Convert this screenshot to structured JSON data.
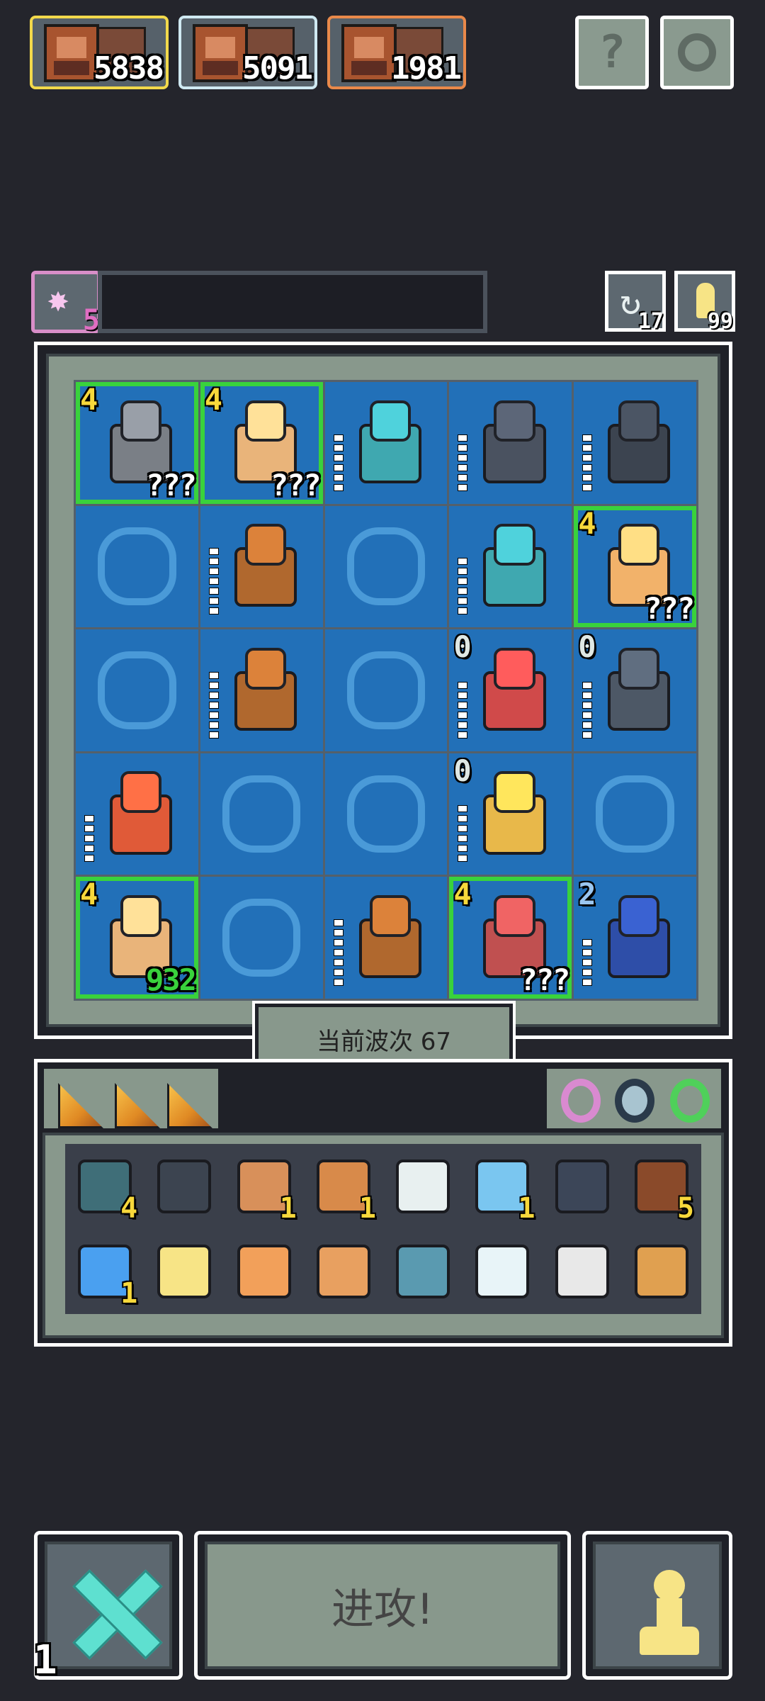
{
  "leaderboard": [
    {
      "score": "5838",
      "border": "#f2d94b"
    },
    {
      "score": "5091",
      "border": "#cfe9f2"
    },
    {
      "score": "1981",
      "border": "#e9894a"
    }
  ],
  "top_buttons": {
    "help_label": "?",
    "settings_icon": "gear-icon"
  },
  "star": {
    "icon": "star-icon",
    "count": "5"
  },
  "side": {
    "refresh_count": "17",
    "key_count": "99"
  },
  "board": {
    "rows": [
      [
        {
          "unit": "armored-knight",
          "level": "4",
          "level_color": "#f7d83b",
          "qty": "???",
          "hp": 0,
          "color": "#7a7f86",
          "highlight": "#39d23c"
        },
        {
          "unit": "musketeer",
          "level": "4",
          "level_color": "#f7d83b",
          "qty": "???",
          "hp": 0,
          "color": "#e9b47a",
          "highlight": "#39d23c"
        },
        {
          "unit": "ogre",
          "level": "",
          "qty": "",
          "hp": 6,
          "color": "#3fa8b0",
          "highlight": ""
        },
        {
          "unit": "dark-knight",
          "level": "",
          "qty": "",
          "hp": 6,
          "color": "#4a5260",
          "highlight": ""
        },
        {
          "unit": "statue",
          "level": "",
          "qty": "",
          "hp": 6,
          "color": "#3c4450",
          "highlight": ""
        }
      ],
      [
        {
          "unit": "",
          "empty": true
        },
        {
          "unit": "warrior",
          "level": "",
          "qty": "",
          "hp": 7,
          "color": "#b0682e",
          "highlight": ""
        },
        {
          "unit": "",
          "empty": true
        },
        {
          "unit": "ogre",
          "level": "",
          "qty": "",
          "hp": 6,
          "color": "#3fa8b0",
          "highlight": ""
        },
        {
          "unit": "golem",
          "level": "4",
          "level_color": "#f7d83b",
          "qty": "???",
          "hp": 0,
          "color": "#f2b26a",
          "highlight": "#39d23c"
        }
      ],
      [
        {
          "unit": "",
          "empty": true
        },
        {
          "unit": "warrior",
          "level": "",
          "qty": "",
          "hp": 7,
          "color": "#b0682e",
          "highlight": ""
        },
        {
          "unit": "",
          "empty": true
        },
        {
          "unit": "old-man",
          "level": "0",
          "level_color": "#dfe8e4",
          "qty": "",
          "hp": 6,
          "color": "#d04a4a",
          "highlight": ""
        },
        {
          "unit": "bear",
          "level": "0",
          "level_color": "#dfe8e4",
          "qty": "",
          "hp": 6,
          "color": "#4d5866",
          "highlight": ""
        }
      ],
      [
        {
          "unit": "dragon",
          "level": "",
          "qty": "",
          "hp": 5,
          "color": "#e05a38",
          "highlight": ""
        },
        {
          "unit": "",
          "empty": true
        },
        {
          "unit": "",
          "empty": true
        },
        {
          "unit": "wheat",
          "level": "0",
          "level_color": "#dfe8e4",
          "qty": "",
          "hp": 6,
          "color": "#e8b84a",
          "highlight": ""
        },
        {
          "unit": "",
          "empty": true
        }
      ],
      [
        {
          "unit": "musketeer",
          "level": "4",
          "level_color": "#f7d83b",
          "qty": "932",
          "qty_color": "#39d23c",
          "hp": 0,
          "color": "#e9b47a",
          "highlight": "#39d23c"
        },
        {
          "unit": "",
          "empty": true
        },
        {
          "unit": "warrior",
          "level": "",
          "qty": "",
          "hp": 7,
          "color": "#b0682e",
          "highlight": ""
        },
        {
          "unit": "guard",
          "level": "4",
          "level_color": "#f7d83b",
          "qty": "???",
          "hp": 0,
          "color": "#c05050",
          "highlight": "#39d23c"
        },
        {
          "unit": "vampire",
          "level": "2",
          "level_color": "#9ac6f0",
          "qty": "",
          "hp": 5,
          "color": "#2e4ea8",
          "highlight": ""
        }
      ]
    ]
  },
  "wave_label": "当前波次 67",
  "shop": {
    "cards": [
      "card-icon",
      "card-icon",
      "card-icon"
    ],
    "rings": [
      {
        "icon": "ring-icon",
        "color": "#d98ad0"
      },
      {
        "icon": "amulet-icon",
        "color": "#2a3a4a"
      },
      {
        "icon": "ring-icon",
        "color": "#4fd05a"
      }
    ]
  },
  "inventory": [
    {
      "icon": "heart-gem-icon",
      "count": "4",
      "color": "#3f6e78"
    },
    {
      "icon": "shield-icon",
      "count": "",
      "color": "#3c4450"
    },
    {
      "icon": "barrel-icon",
      "count": "1",
      "color": "#d8905a"
    },
    {
      "icon": "bell-icon",
      "count": "1",
      "color": "#d88a4a"
    },
    {
      "icon": "feather-icon",
      "count": "",
      "color": "#e8f0f0"
    },
    {
      "icon": "orb-icon",
      "count": "1",
      "color": "#7ac6f0"
    },
    {
      "icon": "sword-icon",
      "count": "",
      "color": "#3c4658"
    },
    {
      "icon": "telescope-icon",
      "count": "5",
      "color": "#8a4a2a"
    },
    {
      "icon": "crystal-icon",
      "count": "1",
      "color": "#4aa0f0"
    },
    {
      "icon": "axe-icon",
      "count": "",
      "color": "#f7e486"
    },
    {
      "icon": "hand-icon",
      "count": "",
      "color": "#f2a05a"
    },
    {
      "icon": "scroll-icon",
      "count": "",
      "color": "#e8a060"
    },
    {
      "icon": "rune-disc-icon",
      "count": "",
      "color": "#5a9ab0"
    },
    {
      "icon": "gear-gem-icon",
      "count": "",
      "color": "#e8f4f8"
    },
    {
      "icon": "dagger-icon",
      "count": "",
      "color": "#e8e8e8"
    },
    {
      "icon": "ship-icon",
      "count": "",
      "color": "#e0a050"
    }
  ],
  "controls": {
    "cancel_count": "1",
    "attack_label": "进攻!",
    "pawn_icon": "pawn-icon"
  }
}
